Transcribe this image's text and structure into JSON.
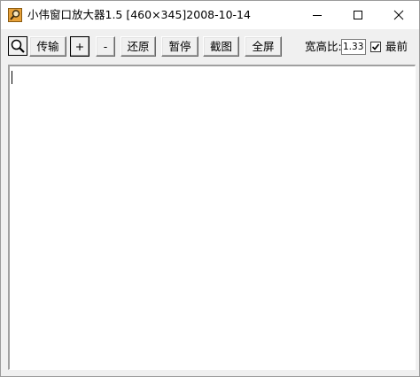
{
  "window": {
    "title": "小伟窗口放大器1.5 [460×345]2008-10-14"
  },
  "icons": {
    "app": "magnifier-app-icon",
    "minimize": "minimize-icon",
    "maximize": "maximize-icon",
    "close": "close-icon",
    "magnifier": "magnifier-icon",
    "check": "checkmark-icon"
  },
  "toolbar": {
    "transfer_label": "传输",
    "zoom_in_label": "+",
    "zoom_out_label": "-",
    "restore_label": "还原",
    "pause_label": "暂停",
    "capture_label": "截图",
    "fullscreen_label": "全屏",
    "aspect_label": "宽高比:",
    "aspect_value": "1.33",
    "topmost_label": "最前",
    "topmost_checked": true
  },
  "colors": {
    "face": "#f0f0f0",
    "view_bg": "#ffffff",
    "icon_orange": "#e8a23a",
    "icon_dark": "#3a2a10"
  }
}
